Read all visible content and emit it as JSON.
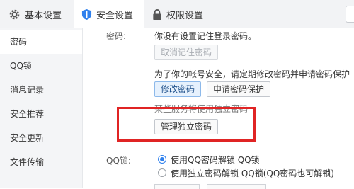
{
  "tabs": [
    {
      "label": "基本设置",
      "icon": "gear-icon"
    },
    {
      "label": "安全设置",
      "icon": "shield-icon"
    },
    {
      "label": "权限设置",
      "icon": "lock-icon"
    }
  ],
  "sidebar": {
    "items": [
      {
        "label": "密码"
      },
      {
        "label": "QQ锁"
      },
      {
        "label": "消息记录"
      },
      {
        "label": "安全推荐"
      },
      {
        "label": "安全更新"
      },
      {
        "label": "文件传输"
      }
    ]
  },
  "password_section": {
    "label": "密码:",
    "status_text": "你没有设置记住登录密码。",
    "cancel_remember_button": "取消记住密码",
    "advice_text": "为了你的帐号安全，请定期修改密码并申请密码保护",
    "change_password_button": "修改密码",
    "apply_protection_button": "申请密码保护",
    "independent_note": "某些服务将使用独立密码",
    "manage_independent_button": "管理独立密码"
  },
  "qqlock_section": {
    "label": "QQ锁:",
    "options": [
      {
        "label": "使用QQ密码解锁 QQ锁",
        "checked": true
      },
      {
        "label": "使用独立密码解锁 QQ锁(QQ密码也可解锁)",
        "checked": false
      }
    ]
  },
  "colors": {
    "accent": "#2f80ed",
    "highlight_box": "#e02424"
  }
}
